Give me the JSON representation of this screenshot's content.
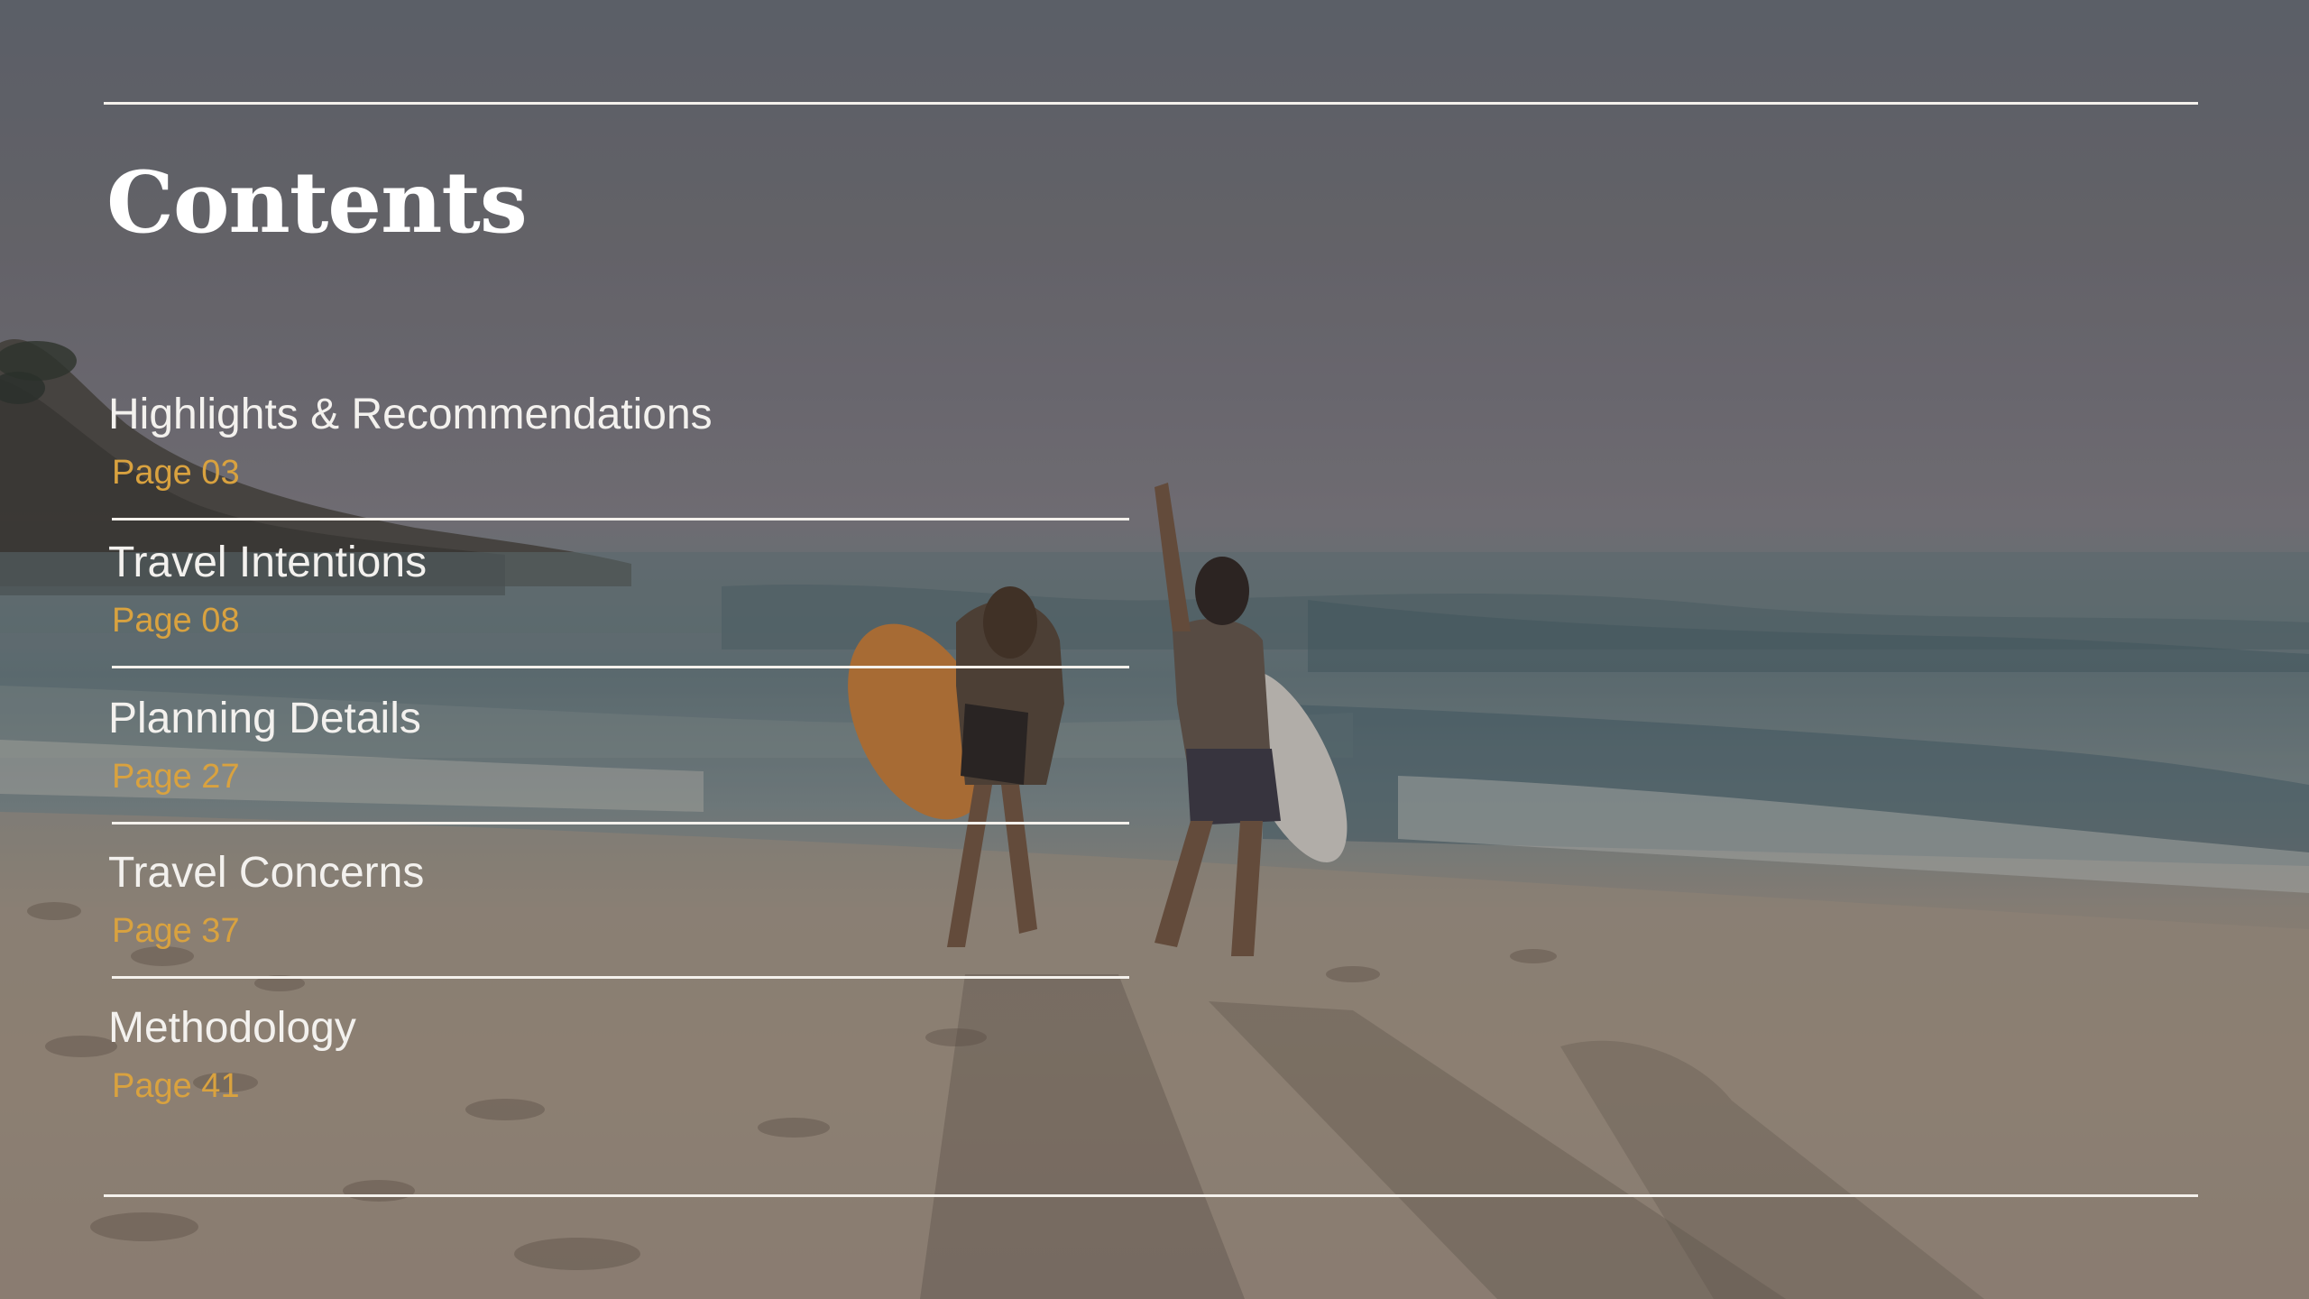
{
  "title": "Contents",
  "toc": [
    {
      "label": "Highlights & Recommendations",
      "page": "Page 03"
    },
    {
      "label": "Travel Intentions",
      "page": "Page 08"
    },
    {
      "label": "Planning Details",
      "page": "Page 27"
    },
    {
      "label": "Travel Concerns",
      "page": "Page 37"
    },
    {
      "label": "Methodology",
      "page": "Page 41"
    }
  ],
  "colors": {
    "title": "#ffffff",
    "label": "#f3f1ee",
    "page_number": "#d9a23f",
    "rule": "#f4f1ec"
  },
  "background": {
    "description_icon": "beach-photo-icon"
  }
}
